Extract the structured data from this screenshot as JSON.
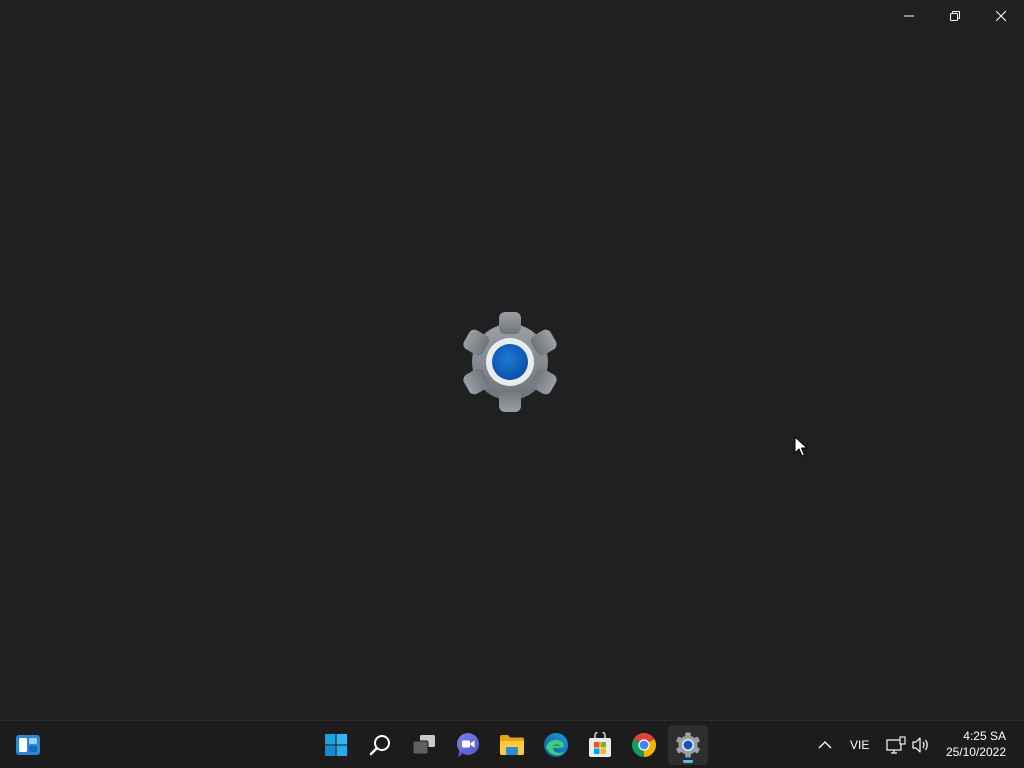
{
  "window": {
    "app_icon": "settings-gear-icon",
    "controls": {
      "minimize": "minimize-icon",
      "restore": "restore-icon",
      "close": "close-icon"
    }
  },
  "taskbar": {
    "left": [
      {
        "name": "widgets",
        "icon": "widgets-icon"
      }
    ],
    "center": [
      {
        "name": "start",
        "icon": "windows-logo-icon"
      },
      {
        "name": "search",
        "icon": "search-icon"
      },
      {
        "name": "task-view",
        "icon": "task-view-icon"
      },
      {
        "name": "chat",
        "icon": "teams-chat-icon"
      },
      {
        "name": "file-explorer",
        "icon": "folder-icon"
      },
      {
        "name": "edge",
        "icon": "edge-browser-icon"
      },
      {
        "name": "store",
        "icon": "microsoft-store-icon"
      },
      {
        "name": "chrome",
        "icon": "chrome-icon"
      },
      {
        "name": "settings",
        "icon": "settings-gear-icon",
        "active": true
      }
    ],
    "tray": {
      "overflow_icon": "chevron-up-icon",
      "language": "VIE",
      "network_icon": "network-icon",
      "volume_icon": "volume-icon",
      "time": "4:25 SA",
      "date": "25/10/2022"
    }
  },
  "colors": {
    "background": "#202020",
    "taskbar": "#1c1c1c",
    "accent": "#4cc2ff"
  }
}
